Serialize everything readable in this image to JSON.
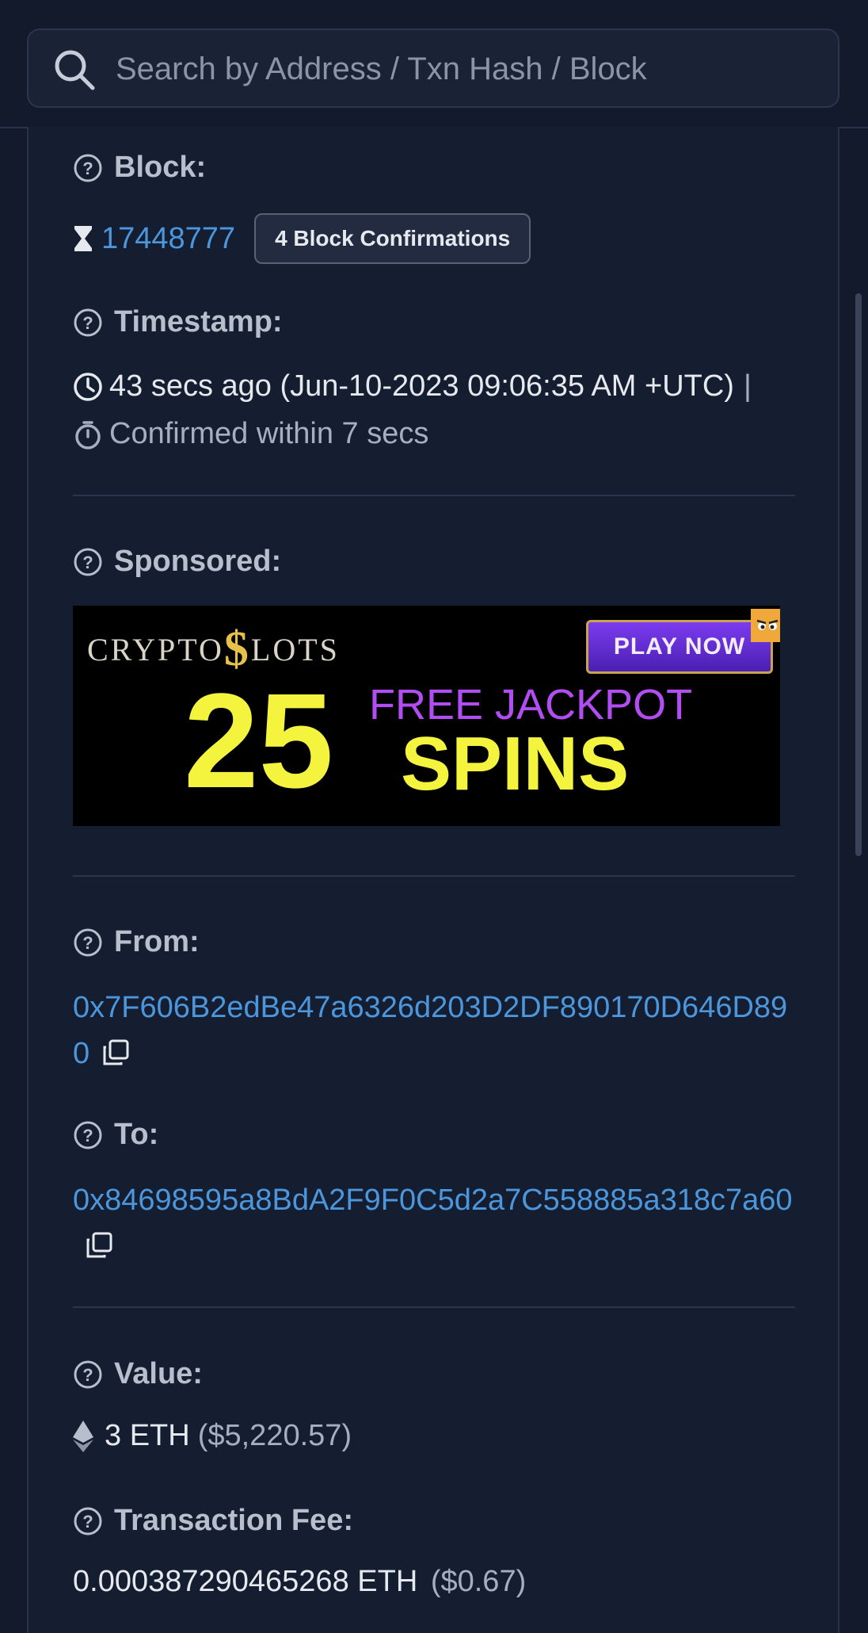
{
  "search": {
    "placeholder": "Search by Address / Txn Hash / Block"
  },
  "block": {
    "label": "Block:",
    "number": "17448777",
    "confirmations": "4 Block Confirmations"
  },
  "timestamp": {
    "label": "Timestamp:",
    "line1": "43 secs ago (Jun-10-2023 09:06:35 AM +UTC)",
    "separator": "|",
    "line2": "Confirmed within 7 secs"
  },
  "sponsored": {
    "label": "Sponsored:",
    "ad": {
      "logo_left": "CRYPTO",
      "logo_dollar": "$",
      "logo_right": "LOTS",
      "play_button": "PLAY NOW",
      "number": "25",
      "line1": "FREE JACKPOT",
      "line2": "SPINS"
    }
  },
  "from": {
    "label": "From:",
    "address": "0x7F606B2edBe47a6326d203D2DF890170D646D890"
  },
  "to": {
    "label": "To:",
    "address": "0x84698595a8BdA2F9F0C5d2a7C558885a318c7a60"
  },
  "value": {
    "label": "Value:",
    "amount": "3 ETH",
    "usd": "($5,220.57)"
  },
  "fee": {
    "label": "Transaction Fee:",
    "amount": "0.000387290465268 ETH",
    "usd": "($0.67)"
  },
  "colors": {
    "link": "#4c96dc",
    "background": "#131a2b",
    "ad_yellow": "#f4f33d",
    "ad_purple": "#b24df4"
  }
}
